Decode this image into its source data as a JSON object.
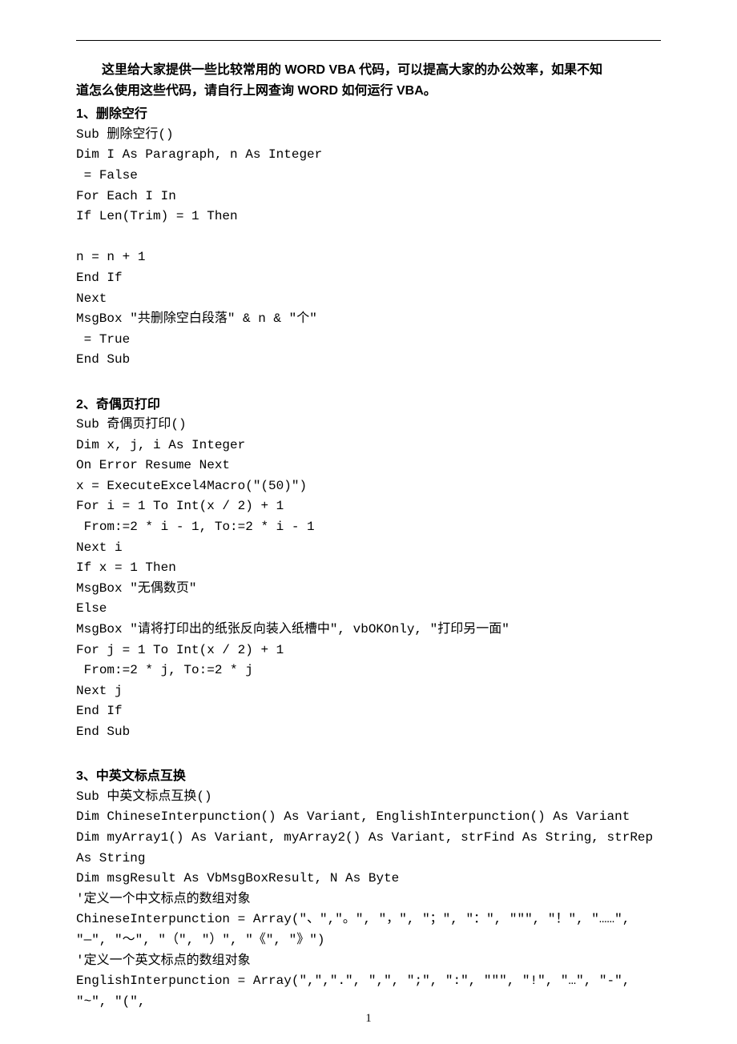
{
  "intro": {
    "line1": "这里给大家提供一些比较常用的 WORD VBA 代码，可以提高大家的办公效率，如果不知",
    "line2": "道怎么使用这些代码，请自行上网查询 WORD 如何运行 VBA。"
  },
  "sections": [
    {
      "heading": "1、删除空行",
      "lines": [
        "Sub 删除空行()",
        "Dim I As Paragraph, n As Integer",
        " = False",
        "For Each I In",
        "If Len(Trim) = 1 Then",
        "",
        "n = n + 1",
        "End If",
        "Next",
        "MsgBox \"共删除空白段落\" & n & \"个\"",
        " = True",
        "End Sub"
      ]
    },
    {
      "heading": "2、奇偶页打印",
      "lines": [
        "Sub 奇偶页打印()",
        "Dim x, j, i As Integer",
        "On Error Resume Next",
        "x = ExecuteExcel4Macro(\"(50)\")",
        "For i = 1 To Int(x / 2) + 1",
        " From:=2 * i - 1, To:=2 * i - 1",
        "Next i",
        "If x = 1 Then",
        "MsgBox \"无偶数页\"",
        "Else",
        "MsgBox \"请将打印出的纸张反向装入纸槽中\", vbOKOnly, \"打印另一面\"",
        "For j = 1 To Int(x / 2) + 1",
        " From:=2 * j, To:=2 * j",
        "Next j",
        "End If",
        "End Sub"
      ]
    },
    {
      "heading": "3、中英文标点互换",
      "lines": [
        "Sub 中英文标点互换()",
        "Dim ChineseInterpunction() As Variant, EnglishInterpunction() As Variant",
        "Dim myArray1() As Variant, myArray2() As Variant, strFind As String, strRep As String",
        "Dim msgResult As VbMsgBoxResult, N As Byte",
        "'定义一个中文标点的数组对象",
        "ChineseInterpunction = Array(\"、\",\"。\", \"，\", \"；\", \"：\", \"\"\", \"！\", \"……\", \"—\", \"～\", \"（\", \"）\", \"《\", \"》\")",
        "'定义一个英文标点的数组对象",
        "EnglishInterpunction = Array(\",\",\".\", \",\", \";\", \":\", \"\"\", \"!\", \"…\", \"-\", \"~\", \"(\","
      ]
    }
  ],
  "pagenum": "1"
}
